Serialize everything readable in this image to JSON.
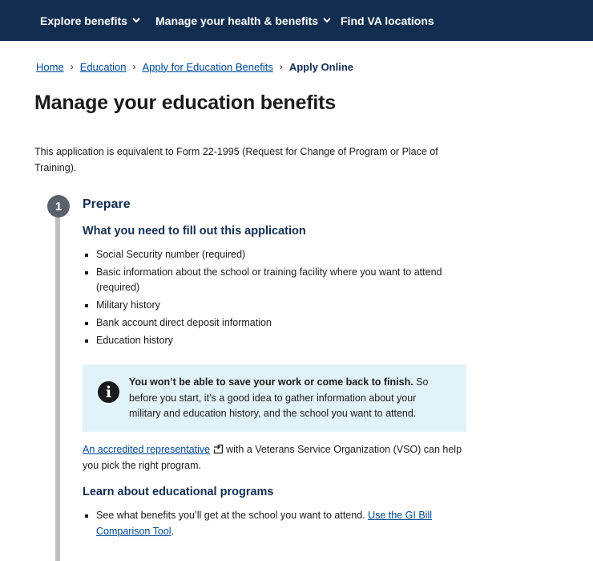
{
  "nav": {
    "items": [
      {
        "label": "Explore benefits",
        "icon": "chevron-down-icon"
      },
      {
        "label": "Manage your health & benefits",
        "icon": "chevron-down-icon"
      },
      {
        "label": "Find VA locations"
      }
    ]
  },
  "breadcrumb": {
    "items": [
      "Home",
      "Education",
      "Apply for Education Benefits"
    ],
    "current": "Apply Online",
    "separator": "›"
  },
  "page": {
    "title": "Manage your education benefits",
    "intro": "This application is equivalent to Form 22-1995 (Request for Change of Program or Place of Training)."
  },
  "step": {
    "number": "1",
    "title": "Prepare",
    "need_heading": "What you need to fill out this application",
    "need_items": [
      "Social Security number (required)",
      "Basic information about the school or training facility where you want to attend (required)",
      "Military history",
      "Bank account direct deposit information",
      "Education history"
    ],
    "alert": {
      "icon": "info-icon",
      "bold": "You won’t be able to save your work or come back to finish.",
      "text": " So before you start, it’s a good idea to gather information about your military and education history, and the school you want to attend."
    },
    "rep": {
      "link": "An accredited representative",
      "icon": "external-link-icon",
      "text": "with a Veterans Service Organization (VSO) can help you pick the right program."
    },
    "learn_heading": "Learn about educational programs",
    "learn_item_text": "See what benefits you’ll get at the school you want to attend. ",
    "learn_item_link": "Use the GI Bill Comparison Tool",
    "learn_item_end": "."
  },
  "colors": {
    "nav_bg": "#112e51",
    "link": "#004795",
    "alert_bg": "#e1f3f8",
    "step_circle": "#5b616b",
    "rail": "#bfbfbf"
  }
}
